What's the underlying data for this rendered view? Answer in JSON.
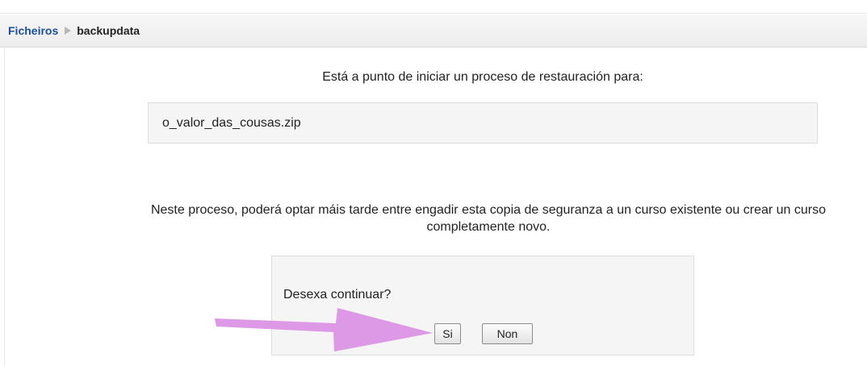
{
  "breadcrumb": {
    "link": "Ficheiros",
    "current": "backupdata"
  },
  "restore": {
    "intro_text": "Está a punto de iniciar un proceso de restauración para:",
    "filename": "o_valor_das_cousas.zip",
    "explanation": "Neste proceso, poderá optar máis tarde entre engadir esta copia de seguranza a un curso existente ou crear un curso completamente novo."
  },
  "confirm": {
    "question": "Desexa continuar?",
    "yes_label": "Si",
    "no_label": "Non"
  },
  "colors": {
    "link": "#1a4f9c",
    "annotation_arrow": "#dd99e6"
  },
  "icons": {
    "breadcrumb_separator": "triangle-right-icon"
  }
}
